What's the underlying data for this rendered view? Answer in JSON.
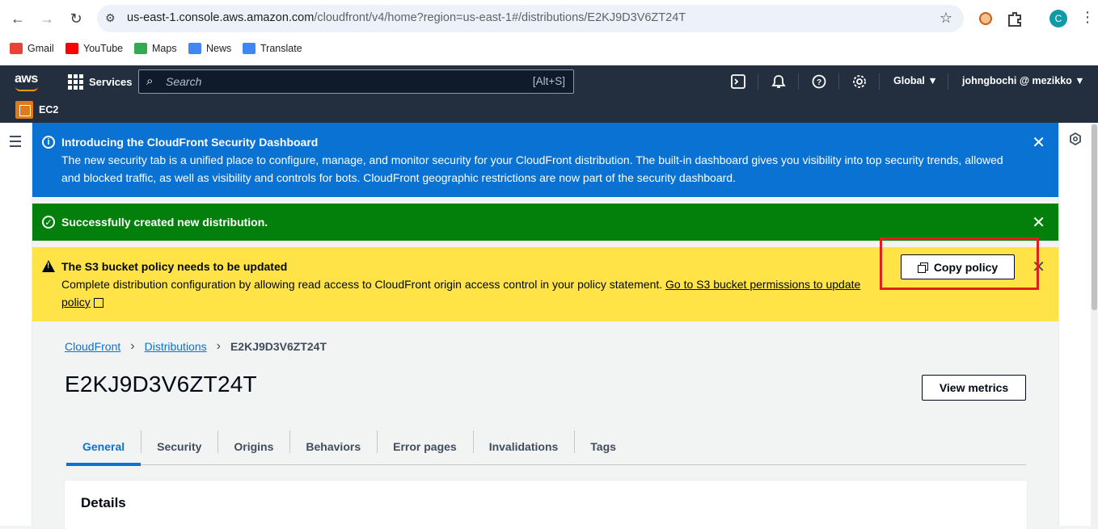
{
  "browser": {
    "url_domain": "us-east-1.console.aws.amazon.com",
    "url_path": "/cloudfront/v4/home?region=us-east-1#/distributions/E2KJ9D3V6ZT24T",
    "profile_initial": "C",
    "bookmarks": [
      {
        "label": "Gmail",
        "color": "#ea4335"
      },
      {
        "label": "YouTube",
        "color": "#ff0000"
      },
      {
        "label": "Maps",
        "color": "#34a853"
      },
      {
        "label": "News",
        "color": "#4285f4"
      },
      {
        "label": "Translate",
        "color": "#4285f4"
      }
    ]
  },
  "aws_nav": {
    "logo": "aws",
    "services_label": "Services",
    "search_placeholder": "Search",
    "search_shortcut": "[Alt+S]",
    "region": "Global ▼",
    "account": "johngbochi @ mezikko ▼",
    "favorite_service": "EC2"
  },
  "flashbars": {
    "info": {
      "title": "Introducing the CloudFront Security Dashboard",
      "body": "The new security tab is a unified place to configure, manage, and monitor security for your CloudFront distribution. The built-in dashboard gives you visibility into top security trends, allowed and blocked traffic, as well as visibility and controls for bots. CloudFront geographic restrictions are now part of the security dashboard."
    },
    "success": {
      "title": "Successfully created new distribution."
    },
    "warning": {
      "title": "The S3 bucket policy needs to be updated",
      "body": "Complete distribution configuration by allowing read access to CloudFront origin access control in your policy statement. ",
      "link_part1": "Go to S3 bucket permissions to update",
      "link_part2": "policy",
      "button_label": "Copy policy"
    }
  },
  "breadcrumb": {
    "items": [
      "CloudFront",
      "Distributions"
    ],
    "current": "E2KJ9D3V6ZT24T"
  },
  "page": {
    "title": "E2KJ9D3V6ZT24T",
    "view_metrics_label": "View metrics",
    "tabs": [
      "General",
      "Security",
      "Origins",
      "Behaviors",
      "Error pages",
      "Invalidations",
      "Tags"
    ],
    "active_tab": "General",
    "details_heading": "Details"
  },
  "colors": {
    "info": "#0972d3",
    "success": "#037f0c",
    "warning": "#ffe347",
    "nav": "#232f3e",
    "highlight": "#e0201c"
  }
}
